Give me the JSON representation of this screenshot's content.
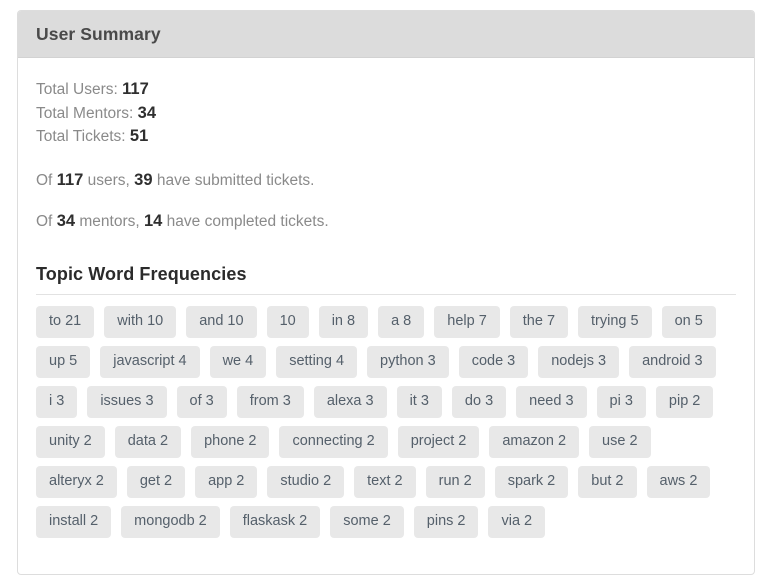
{
  "panel": {
    "title": "User Summary"
  },
  "summary": {
    "stats": [
      {
        "label": "Total Users:",
        "value": "117"
      },
      {
        "label": "Total Mentors:",
        "value": "34"
      },
      {
        "label": "Total Tickets:",
        "value": "51"
      }
    ],
    "sentences": [
      {
        "prefix": "Of",
        "value1": "117",
        "middle": "users,",
        "value2": "39",
        "suffix": "have submitted tickets."
      },
      {
        "prefix": "Of",
        "value1": "34",
        "middle": "mentors,",
        "value2": "14",
        "suffix": "have completed tickets."
      }
    ]
  },
  "topic": {
    "heading": "Topic Word Frequencies",
    "words": [
      {
        "word": "to",
        "count": 21,
        "label": "to 21"
      },
      {
        "word": "with",
        "count": 10,
        "label": "with 10"
      },
      {
        "word": "and",
        "count": 10,
        "label": "and 10"
      },
      {
        "word": "",
        "count": 10,
        "label": "10"
      },
      {
        "word": "in",
        "count": 8,
        "label": "in 8"
      },
      {
        "word": "a",
        "count": 8,
        "label": "a 8"
      },
      {
        "word": "help",
        "count": 7,
        "label": "help 7"
      },
      {
        "word": "the",
        "count": 7,
        "label": "the 7"
      },
      {
        "word": "trying",
        "count": 5,
        "label": "trying 5"
      },
      {
        "word": "on",
        "count": 5,
        "label": "on 5"
      },
      {
        "word": "up",
        "count": 5,
        "label": "up 5"
      },
      {
        "word": "javascript",
        "count": 4,
        "label": "javascript 4"
      },
      {
        "word": "we",
        "count": 4,
        "label": "we 4"
      },
      {
        "word": "setting",
        "count": 4,
        "label": "setting 4"
      },
      {
        "word": "python",
        "count": 3,
        "label": "python 3"
      },
      {
        "word": "code",
        "count": 3,
        "label": "code 3"
      },
      {
        "word": "nodejs",
        "count": 3,
        "label": "nodejs 3"
      },
      {
        "word": "android",
        "count": 3,
        "label": "android 3"
      },
      {
        "word": "i",
        "count": 3,
        "label": "i 3"
      },
      {
        "word": "issues",
        "count": 3,
        "label": "issues 3"
      },
      {
        "word": "of",
        "count": 3,
        "label": "of 3"
      },
      {
        "word": "from",
        "count": 3,
        "label": "from 3"
      },
      {
        "word": "alexa",
        "count": 3,
        "label": "alexa 3"
      },
      {
        "word": "it",
        "count": 3,
        "label": "it 3"
      },
      {
        "word": "do",
        "count": 3,
        "label": "do 3"
      },
      {
        "word": "need",
        "count": 3,
        "label": "need 3"
      },
      {
        "word": "pi",
        "count": 3,
        "label": "pi 3"
      },
      {
        "word": "pip",
        "count": 2,
        "label": "pip 2"
      },
      {
        "word": "unity",
        "count": 2,
        "label": "unity 2"
      },
      {
        "word": "data",
        "count": 2,
        "label": "data 2"
      },
      {
        "word": "phone",
        "count": 2,
        "label": "phone 2"
      },
      {
        "word": "connecting",
        "count": 2,
        "label": "connecting 2"
      },
      {
        "word": "project",
        "count": 2,
        "label": "project 2"
      },
      {
        "word": "amazon",
        "count": 2,
        "label": "amazon 2"
      },
      {
        "word": "use",
        "count": 2,
        "label": "use 2"
      },
      {
        "word": "alteryx",
        "count": 2,
        "label": "alteryx 2"
      },
      {
        "word": "get",
        "count": 2,
        "label": "get 2"
      },
      {
        "word": "app",
        "count": 2,
        "label": "app 2"
      },
      {
        "word": "studio",
        "count": 2,
        "label": "studio 2"
      },
      {
        "word": "text",
        "count": 2,
        "label": "text 2"
      },
      {
        "word": "run",
        "count": 2,
        "label": "run 2"
      },
      {
        "word": "spark",
        "count": 2,
        "label": "spark 2"
      },
      {
        "word": "but",
        "count": 2,
        "label": "but 2"
      },
      {
        "word": "aws",
        "count": 2,
        "label": "aws 2"
      },
      {
        "word": "install",
        "count": 2,
        "label": "install 2"
      },
      {
        "word": "mongodb",
        "count": 2,
        "label": "mongodb 2"
      },
      {
        "word": "flaskask",
        "count": 2,
        "label": "flaskask 2"
      },
      {
        "word": "some",
        "count": 2,
        "label": "some 2"
      },
      {
        "word": "pins",
        "count": 2,
        "label": "pins 2"
      },
      {
        "word": "via",
        "count": 2,
        "label": "via 2"
      }
    ]
  },
  "colors": {
    "panel_header_bg": "#dcdcdc",
    "panel_border": "#dddddd",
    "badge_bg": "#e8e8e8",
    "badge_text": "#55606b",
    "muted_text": "#8a8a8a",
    "strong_text": "#2f2f2f"
  }
}
